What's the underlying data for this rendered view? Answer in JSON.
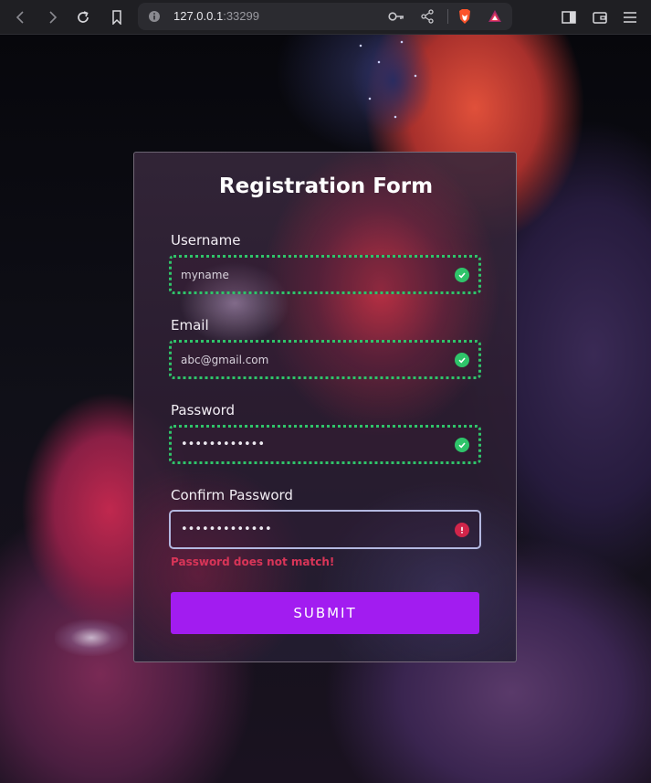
{
  "browser": {
    "url_host": "127.0.0.1",
    "url_port": ":33299"
  },
  "form": {
    "title": "Registration Form",
    "fields": [
      {
        "label": "Username",
        "value": "myname",
        "status": "valid"
      },
      {
        "label": "Email",
        "value": "abc@gmail.com",
        "status": "valid"
      },
      {
        "label": "Password",
        "value": "••••••••••••",
        "status": "valid"
      },
      {
        "label": "Confirm Password",
        "value": "•••••••••••••",
        "status": "invalid"
      }
    ],
    "error_message": "Password does not match!",
    "submit_label": "SUBMIT"
  },
  "colors": {
    "valid": "#2fc46a",
    "invalid": "#d1254a",
    "submit": "#a21cf0"
  }
}
